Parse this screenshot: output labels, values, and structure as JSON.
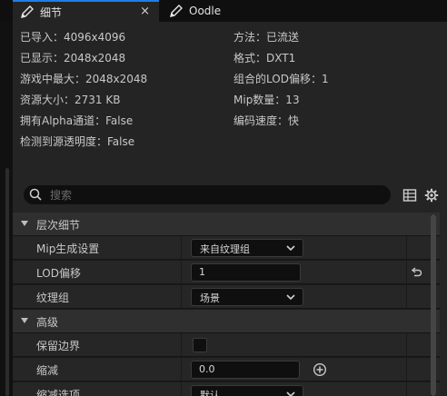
{
  "tabs": [
    {
      "label": "细节",
      "icon": "pencil-icon",
      "active": true,
      "close": "×"
    },
    {
      "label": "Oodle",
      "icon": "pencil-icon",
      "active": false
    }
  ],
  "info": {
    "left": [
      "已导入：4096x4096",
      "已显示：2048x2048",
      "游戏中最大：2048x2048",
      "资源大小：2731 KB",
      "拥有Alpha通道：False",
      "检测到源透明度：False"
    ],
    "right": [
      "方法：已流送",
      "格式：DXT1",
      "组合的LOD偏移：1",
      "Mip数量：13",
      "编码速度：快"
    ]
  },
  "search": {
    "placeholder": "搜索",
    "value": ""
  },
  "toolbar": {
    "table_icon": "table-view-icon",
    "settings_icon": "gear-icon"
  },
  "details": {
    "cat_lod": "层次细节",
    "mip_label": "Mip生成设置",
    "mip_value": "来自纹理组",
    "lod_label": "LOD偏移",
    "lod_value": "1",
    "group_label": "纹理组",
    "group_value": "场景",
    "cat_adv": "高级",
    "border_label": "保留边界",
    "border_checked": false,
    "reduce_label": "缩减",
    "reduce_value": "0.0",
    "reduce_opt_label": "缩减选项",
    "reduce_opt_value": "默认"
  },
  "colors": {
    "accent": "#1f7ee8",
    "panel": "#242424",
    "background": "#151515"
  }
}
